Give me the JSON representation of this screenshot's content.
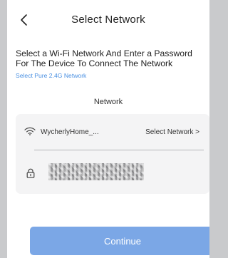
{
  "header": {
    "title": "Select Network",
    "back_icon": "chevron-left-icon"
  },
  "instructions": {
    "text": "Select a Wi-Fi Network And Enter a Password For The Device To Connect The Network",
    "link": "Select Pure 2.4G Network"
  },
  "network": {
    "section_label": "Network",
    "ssid": "WycherlyHome_...",
    "select_label": "Select  Network  >",
    "wifi_icon": "wifi-icon"
  },
  "password": {
    "lock_icon": "lock-icon",
    "value_state": "obscured"
  },
  "actions": {
    "continue_label": "Continue"
  },
  "colors": {
    "accent": "#4a90e2",
    "button": "#7ba7e6",
    "card": "#f4f4f5",
    "backdrop": "#c9cacc"
  }
}
